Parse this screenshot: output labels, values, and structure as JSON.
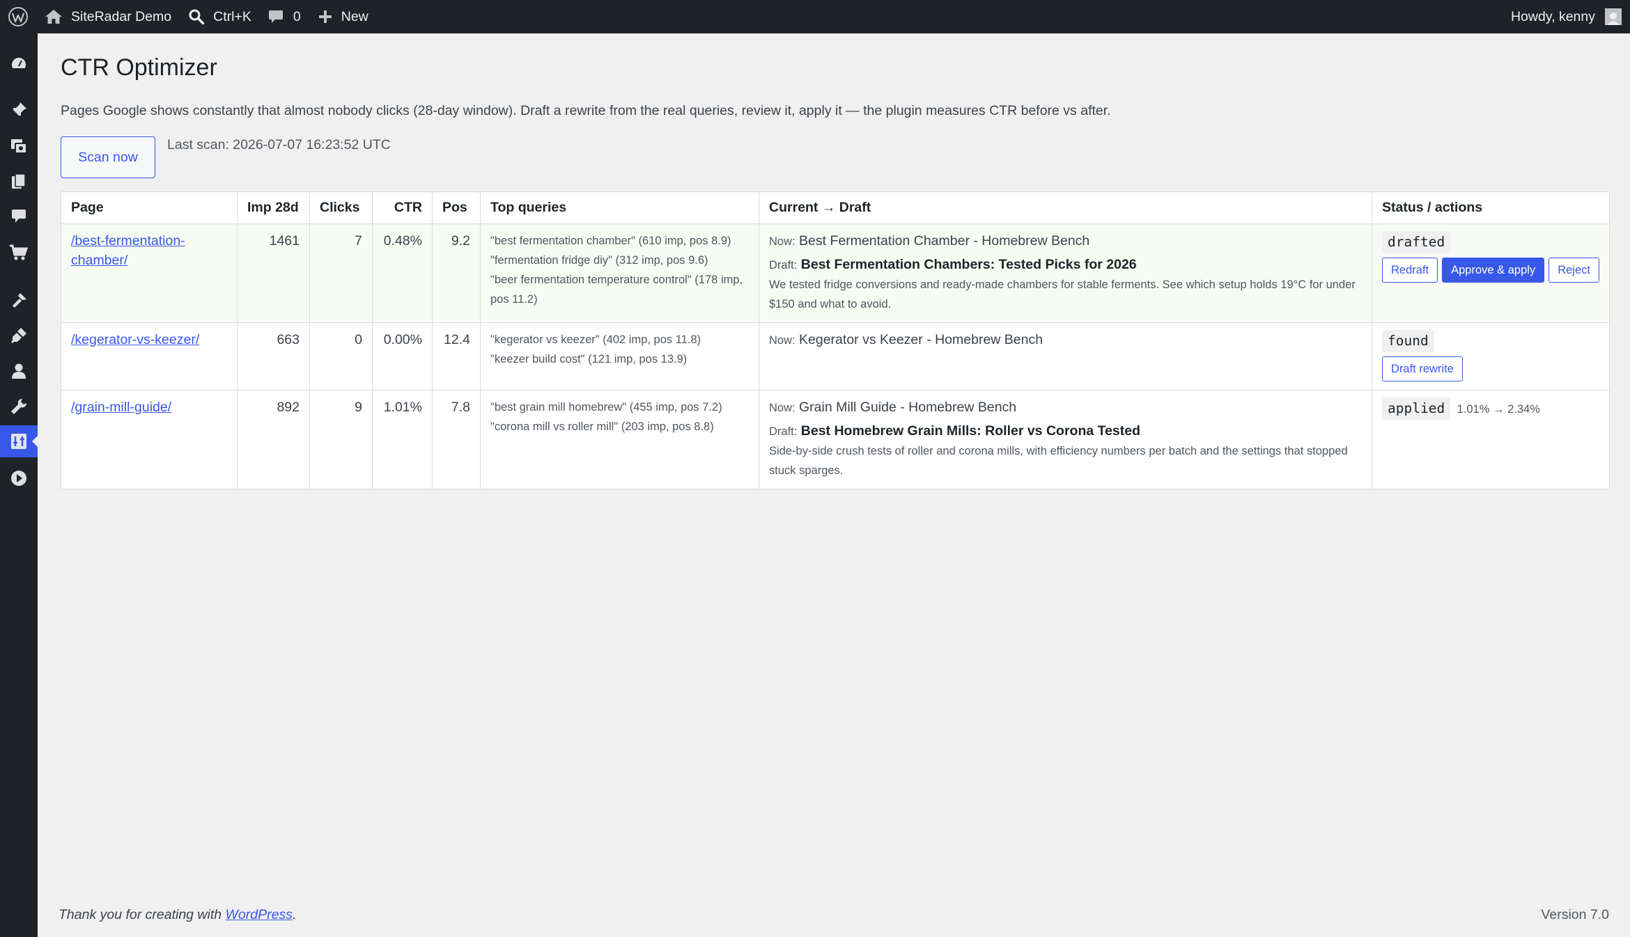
{
  "admin_bar": {
    "site_name": "SiteRadar Demo",
    "search_shortcut": "Ctrl+K",
    "comments_count": "0",
    "new_label": "New",
    "greeting": "Howdy, kenny"
  },
  "page": {
    "title": "CTR Optimizer",
    "description": "Pages Google shows constantly that almost nobody clicks (28-day window). Draft a rewrite from the real queries, review it, apply it — the plugin measures CTR before vs after.",
    "scan_button": "Scan now",
    "last_scan": "Last scan: 2026-07-07 16:23:52 UTC"
  },
  "table": {
    "headers": {
      "page": "Page",
      "imp": "Imp 28d",
      "clicks": "Clicks",
      "ctr": "CTR",
      "pos": "Pos",
      "queries": "Top queries",
      "current_draft": "Current → Draft",
      "status": "Status / actions"
    },
    "rows": [
      {
        "page": "/best-fermentation-chamber/",
        "imp": "1461",
        "clicks": "7",
        "ctr": "0.48%",
        "pos": "9.2",
        "queries": [
          "\"best fermentation chamber\" (610 imp, pos 8.9)",
          "\"fermentation fridge diy\" (312 imp, pos 9.6)",
          "\"beer fermentation temperature control\" (178 imp, pos 11.2)"
        ],
        "now_label": "Now:",
        "now_title": "Best Fermentation Chamber - Homebrew Bench",
        "draft_label": "Draft:",
        "draft_title": "Best Fermentation Chambers: Tested Picks for 2026",
        "draft_desc": "We tested fridge conversions and ready-made chambers for stable ferments. See which setup holds 19°C for under $150 and what to avoid.",
        "status": "drafted",
        "actions": [
          "Redraft",
          "Approve & apply",
          "Reject"
        ]
      },
      {
        "page": "/kegerator-vs-keezer/",
        "imp": "663",
        "clicks": "0",
        "ctr": "0.00%",
        "pos": "12.4",
        "queries": [
          "\"kegerator vs keezer\" (402 imp, pos 11.8)",
          "\"keezer build cost\" (121 imp, pos 13.9)"
        ],
        "now_label": "Now:",
        "now_title": "Kegerator vs Keezer - Homebrew Bench",
        "status": "found",
        "actions": [
          "Draft rewrite"
        ]
      },
      {
        "page": "/grain-mill-guide/",
        "imp": "892",
        "clicks": "9",
        "ctr": "1.01%",
        "pos": "7.8",
        "queries": [
          "\"best grain mill homebrew\" (455 imp, pos 7.2)",
          "\"corona mill vs roller mill\" (203 imp, pos 8.8)"
        ],
        "now_label": "Now:",
        "now_title": "Grain Mill Guide - Homebrew Bench",
        "draft_label": "Draft:",
        "draft_title": "Best Homebrew Grain Mills: Roller vs Corona Tested",
        "draft_desc": "Side-by-side crush tests of roller and corona mills, with efficiency numbers per batch and the settings that stopped stuck sparges.",
        "status": "applied",
        "delta": "1.01% → 2.34%"
      }
    ]
  },
  "footer": {
    "thanks_prefix": "Thank you for creating with ",
    "thanks_link": "WordPress",
    "thanks_suffix": ".",
    "version": "Version 7.0"
  },
  "colors": {
    "admin_bar_bg": "#1d2327",
    "accent": "#3858e9",
    "page_bg": "#f0f0f1",
    "drafted_row_bg": "#f6fbf4"
  },
  "icons": {
    "admin_bar": [
      "wordpress-logo-icon",
      "home-icon",
      "search-icon",
      "comment-icon",
      "plus-icon",
      "avatar"
    ],
    "side_menu": [
      "dashboard-icon",
      "pin-icon",
      "media-icon",
      "pages-icon",
      "comments-icon",
      "cart-icon",
      "appearance-icon",
      "plugins-icon",
      "users-icon",
      "tools-icon",
      "settings-icon",
      "play-icon"
    ]
  }
}
